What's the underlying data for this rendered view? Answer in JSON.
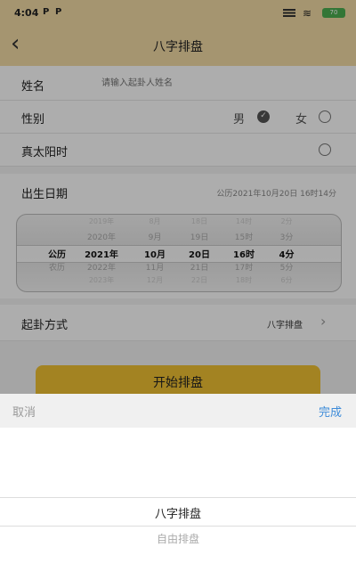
{
  "status_bar": {
    "time": "4:04",
    "icons": [
      "P",
      "P"
    ],
    "battery": "70"
  },
  "nav": {
    "title": "八字排盘"
  },
  "form": {
    "name_label": "姓名",
    "name_placeholder": "请输入起卦人姓名",
    "gender_label": "性别",
    "gender_male": "男",
    "gender_female": "女",
    "solar_label": "真太阳时",
    "birth_label": "出生日期",
    "birth_value": "公历2021年10月20日 16时14分",
    "method_label": "起卦方式",
    "method_value": "八字排盘"
  },
  "wheel": {
    "cal": [
      "公历",
      "农历"
    ],
    "year": [
      "2019年",
      "2020年",
      "2021年",
      "2022年",
      "2023年"
    ],
    "month": [
      "8月",
      "9月",
      "10月",
      "11月",
      "12月"
    ],
    "day": [
      "18日",
      "19日",
      "20日",
      "21日",
      "22日"
    ],
    "hour": [
      "14时",
      "15时",
      "16时",
      "17时",
      "18时"
    ],
    "minute": [
      "2分",
      "3分",
      "4分",
      "5分",
      "6分"
    ]
  },
  "start_button": "开始排盘",
  "sheet": {
    "cancel": "取消",
    "done": "完成",
    "options": [
      "八字排盘",
      "自由排盘"
    ]
  },
  "colors": {
    "accent": "#f1c233",
    "link": "#3d8bd9",
    "header": "#f3dca6"
  }
}
